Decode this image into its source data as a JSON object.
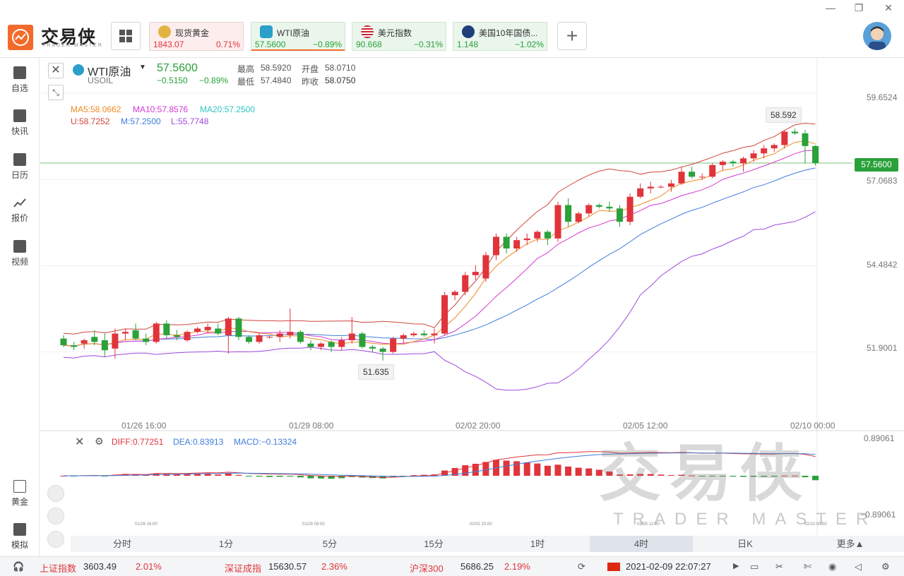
{
  "app": {
    "logo_text": "交易侠",
    "logo_sub": "TRADER MASTER",
    "window_controls": [
      "—",
      "❐",
      "✕"
    ]
  },
  "quotes": [
    {
      "name": "现货黄金",
      "price": "1843.07",
      "change": "0.71%",
      "direction": "up",
      "icon": "gold-icon"
    },
    {
      "name": "WTI原油",
      "price": "57.5600",
      "change": "−0.89%",
      "direction": "down",
      "icon": "oil-icon"
    },
    {
      "name": "美元指数",
      "price": "90.668",
      "change": "−0.31%",
      "direction": "down",
      "icon": "us-flag-icon"
    },
    {
      "name": "美国10年国债...",
      "price": "1.148",
      "change": "−1.02%",
      "direction": "down",
      "icon": "bond-icon"
    }
  ],
  "sidebar": [
    {
      "label": "自选",
      "icon": "plus-square-icon"
    },
    {
      "label": "快讯",
      "icon": "news-icon"
    },
    {
      "label": "日历",
      "icon": "calendar-icon"
    },
    {
      "label": "报价",
      "icon": "trend-icon"
    },
    {
      "label": "视频",
      "icon": "play-icon"
    },
    {
      "label": "黄金",
      "icon": "sge-icon"
    },
    {
      "label": "模拟",
      "icon": "wallet-icon"
    }
  ],
  "header": {
    "symbol_name": "WTI原油",
    "symbol_code": "USOIL",
    "price": "57.5600",
    "change": "−0.5150",
    "change_pct": "−0.89%",
    "high_label": "最高",
    "high": "58.5920",
    "low_label": "最低",
    "low": "57.4840",
    "open_label": "开盘",
    "open": "58.0710",
    "prev_label": "昨收",
    "prev": "58.0750"
  },
  "indicators": {
    "ma5": "MA5:58.0662",
    "ma10": "MA10:57.8576",
    "ma20": "MA20:57.2500",
    "boll_u": "U:58.7252",
    "boll_m": "M:57.2500",
    "boll_l": "L:55.7748"
  },
  "macd": {
    "diff": "DIFF:0.77251",
    "dea": "DEA:0.83913",
    "macd": "MACD:−0.13324",
    "axis_top": "0.89061",
    "axis_bottom": "−0.89061"
  },
  "price_axis": [
    "59.6524",
    "57.0683",
    "54.4842",
    "51.9001"
  ],
  "current_price_tag": "57.5600",
  "callouts": {
    "high": "58.592",
    "low": "51.635"
  },
  "time_axis": [
    "01/26 16:00",
    "01/29 08:00",
    "02/02 20:00",
    "02/05 12:00",
    "02/10 00:00"
  ],
  "time_axis_small": [
    "01/26 16:00",
    "01/29 08:00",
    "02/02 20:00",
    "02/05 12:00",
    "02/10 00:00"
  ],
  "timeframes": [
    "分时",
    "1分",
    "5分",
    "15分",
    "1时",
    "4时",
    "日K",
    "更多▲"
  ],
  "active_timeframe": "4时",
  "status": {
    "idx1_name": "上证指数",
    "idx1_value": "3603.49",
    "idx1_change": "2.01%",
    "idx2_name": "深证成指",
    "idx2_value": "15630.57",
    "idx2_change": "2.36%",
    "idx3_name": "沪深300",
    "idx3_value": "5686.25",
    "idx3_change": "2.19%",
    "datetime": "2021-02-09 22:07:27"
  },
  "watermark": {
    "main": "交易侠",
    "sub": "TRADER MASTER"
  },
  "chart_data": {
    "type": "candlestick",
    "title": "WTI原油 4时",
    "ylim": [
      49.5,
      60.5
    ],
    "candles": [
      {
        "o": 52.3,
        "h": 52.4,
        "l": 52.05,
        "c": 52.1
      },
      {
        "o": 52.1,
        "h": 52.2,
        "l": 51.95,
        "c": 52.05
      },
      {
        "o": 52.15,
        "h": 52.3,
        "l": 52.0,
        "c": 52.25
      },
      {
        "o": 52.35,
        "h": 52.55,
        "l": 52.1,
        "c": 52.2
      },
      {
        "o": 52.25,
        "h": 52.45,
        "l": 51.75,
        "c": 51.95
      },
      {
        "o": 52.0,
        "h": 52.6,
        "l": 51.7,
        "c": 52.45
      },
      {
        "o": 52.45,
        "h": 52.6,
        "l": 52.25,
        "c": 52.5
      },
      {
        "o": 52.55,
        "h": 52.75,
        "l": 52.25,
        "c": 52.3
      },
      {
        "o": 52.3,
        "h": 52.45,
        "l": 52.1,
        "c": 52.2
      },
      {
        "o": 52.2,
        "h": 52.8,
        "l": 52.15,
        "c": 52.75
      },
      {
        "o": 52.75,
        "h": 52.85,
        "l": 52.3,
        "c": 52.4
      },
      {
        "o": 52.4,
        "h": 52.55,
        "l": 52.25,
        "c": 52.35
      },
      {
        "o": 52.25,
        "h": 52.55,
        "l": 52.2,
        "c": 52.5
      },
      {
        "o": 52.5,
        "h": 52.65,
        "l": 52.45,
        "c": 52.6
      },
      {
        "o": 52.55,
        "h": 52.75,
        "l": 52.45,
        "c": 52.65
      },
      {
        "o": 52.6,
        "h": 52.75,
        "l": 52.4,
        "c": 52.45
      },
      {
        "o": 52.4,
        "h": 52.95,
        "l": 51.85,
        "c": 52.9
      },
      {
        "o": 52.9,
        "h": 52.95,
        "l": 52.25,
        "c": 52.35
      },
      {
        "o": 52.35,
        "h": 52.4,
        "l": 52.15,
        "c": 52.2
      },
      {
        "o": 52.2,
        "h": 52.45,
        "l": 52.15,
        "c": 52.4
      },
      {
        "o": 52.35,
        "h": 52.4,
        "l": 52.3,
        "c": 52.35
      },
      {
        "o": 52.35,
        "h": 52.55,
        "l": 52.2,
        "c": 52.45
      },
      {
        "o": 52.4,
        "h": 53.2,
        "l": 52.3,
        "c": 52.5
      },
      {
        "o": 52.5,
        "h": 52.55,
        "l": 52.15,
        "c": 52.2
      },
      {
        "o": 52.15,
        "h": 52.25,
        "l": 51.95,
        "c": 52.05
      },
      {
        "o": 52.05,
        "h": 52.2,
        "l": 51.95,
        "c": 52.15
      },
      {
        "o": 52.2,
        "h": 52.25,
        "l": 51.9,
        "c": 52.05
      },
      {
        "o": 52.05,
        "h": 52.35,
        "l": 51.95,
        "c": 52.25
      },
      {
        "o": 52.25,
        "h": 52.95,
        "l": 52.15,
        "c": 52.45
      },
      {
        "o": 52.45,
        "h": 52.5,
        "l": 52.0,
        "c": 52.05
      },
      {
        "o": 52.05,
        "h": 52.1,
        "l": 51.9,
        "c": 52.0
      },
      {
        "o": 52.0,
        "h": 52.05,
        "l": 51.64,
        "c": 51.9
      },
      {
        "o": 51.9,
        "h": 52.35,
        "l": 51.85,
        "c": 52.3
      },
      {
        "o": 52.3,
        "h": 52.45,
        "l": 52.15,
        "c": 52.4
      },
      {
        "o": 52.4,
        "h": 52.5,
        "l": 52.35,
        "c": 52.45
      },
      {
        "o": 52.45,
        "h": 52.55,
        "l": 52.35,
        "c": 52.4
      },
      {
        "o": 52.4,
        "h": 52.6,
        "l": 52.15,
        "c": 52.45
      },
      {
        "o": 52.45,
        "h": 53.7,
        "l": 52.4,
        "c": 53.6
      },
      {
        "o": 53.6,
        "h": 53.75,
        "l": 53.45,
        "c": 53.7
      },
      {
        "o": 53.7,
        "h": 54.3,
        "l": 53.6,
        "c": 54.2
      },
      {
        "o": 54.2,
        "h": 54.5,
        "l": 54.05,
        "c": 54.3
      },
      {
        "o": 54.1,
        "h": 54.9,
        "l": 54.0,
        "c": 54.8
      },
      {
        "o": 54.8,
        "h": 55.45,
        "l": 54.65,
        "c": 55.35
      },
      {
        "o": 55.35,
        "h": 55.45,
        "l": 54.85,
        "c": 55.0
      },
      {
        "o": 55.0,
        "h": 55.35,
        "l": 54.9,
        "c": 55.25
      },
      {
        "o": 55.25,
        "h": 55.45,
        "l": 55.1,
        "c": 55.3
      },
      {
        "o": 55.3,
        "h": 55.55,
        "l": 55.2,
        "c": 55.5
      },
      {
        "o": 55.5,
        "h": 55.55,
        "l": 55.1,
        "c": 55.3
      },
      {
        "o": 55.3,
        "h": 56.4,
        "l": 55.2,
        "c": 56.3
      },
      {
        "o": 56.3,
        "h": 56.5,
        "l": 55.65,
        "c": 55.8
      },
      {
        "o": 55.8,
        "h": 56.1,
        "l": 55.75,
        "c": 56.05
      },
      {
        "o": 56.05,
        "h": 56.35,
        "l": 55.95,
        "c": 56.3
      },
      {
        "o": 56.3,
        "h": 56.35,
        "l": 56.2,
        "c": 56.25
      },
      {
        "o": 56.25,
        "h": 56.4,
        "l": 56.1,
        "c": 56.2
      },
      {
        "o": 56.2,
        "h": 56.3,
        "l": 55.65,
        "c": 55.8
      },
      {
        "o": 55.8,
        "h": 56.65,
        "l": 55.7,
        "c": 56.55
      },
      {
        "o": 56.55,
        "h": 56.95,
        "l": 56.5,
        "c": 56.8
      },
      {
        "o": 56.8,
        "h": 57.0,
        "l": 56.65,
        "c": 56.85
      },
      {
        "o": 56.85,
        "h": 56.9,
        "l": 56.8,
        "c": 56.85
      },
      {
        "o": 56.85,
        "h": 57.05,
        "l": 56.7,
        "c": 56.95
      },
      {
        "o": 56.95,
        "h": 57.45,
        "l": 56.9,
        "c": 57.3
      },
      {
        "o": 57.3,
        "h": 57.45,
        "l": 57.1,
        "c": 57.15
      },
      {
        "o": 57.15,
        "h": 57.25,
        "l": 57.05,
        "c": 57.15
      },
      {
        "o": 57.15,
        "h": 57.55,
        "l": 57.1,
        "c": 57.5
      },
      {
        "o": 57.5,
        "h": 57.65,
        "l": 57.35,
        "c": 57.6
      },
      {
        "o": 57.6,
        "h": 57.65,
        "l": 57.45,
        "c": 57.55
      },
      {
        "o": 57.55,
        "h": 57.75,
        "l": 57.3,
        "c": 57.7
      },
      {
        "o": 57.7,
        "h": 57.95,
        "l": 57.6,
        "c": 57.85
      },
      {
        "o": 57.85,
        "h": 58.1,
        "l": 57.7,
        "c": 58.0
      },
      {
        "o": 58.0,
        "h": 58.15,
        "l": 57.9,
        "c": 58.1
      },
      {
        "o": 58.1,
        "h": 58.55,
        "l": 58.0,
        "c": 58.5
      },
      {
        "o": 58.5,
        "h": 58.59,
        "l": 58.4,
        "c": 58.45
      },
      {
        "o": 58.45,
        "h": 58.55,
        "l": 57.55,
        "c": 58.07
      },
      {
        "o": 58.07,
        "h": 58.1,
        "l": 57.48,
        "c": 57.56
      }
    ]
  }
}
